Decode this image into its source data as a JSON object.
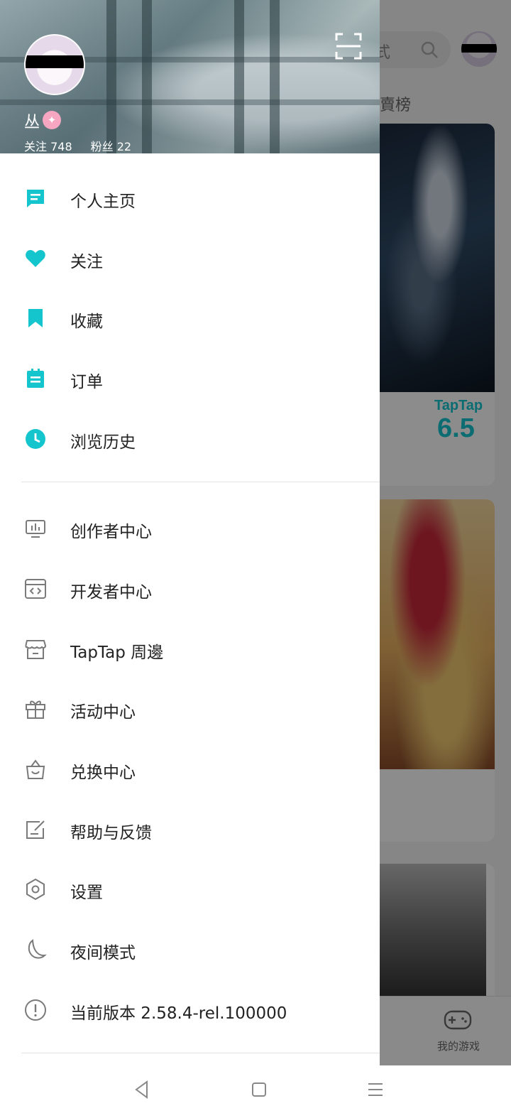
{
  "background": {
    "search_placeholder_fragment": "式",
    "section_title_fragment": "賣榜",
    "score_brand": "TapTap",
    "score_value": "6.5",
    "tab_my_games_label": "我的游戏"
  },
  "drawer": {
    "user": {
      "name": "丛",
      "badge_icon": "unicorn-badge-icon",
      "following": "关注 748",
      "followers": "粉丝 22"
    },
    "primary_items": [
      {
        "label": "个人主页",
        "icon": "profile-card-icon"
      },
      {
        "label": "关注",
        "icon": "heart-icon"
      },
      {
        "label": "收藏",
        "icon": "bookmark-icon"
      },
      {
        "label": "订单",
        "icon": "order-icon"
      },
      {
        "label": "浏览历史",
        "icon": "clock-icon"
      }
    ],
    "secondary_items": [
      {
        "label": "创作者中心",
        "icon": "creator-monitor-icon"
      },
      {
        "label": "开发者中心",
        "icon": "code-window-icon"
      },
      {
        "label": "TapTap 周邊",
        "icon": "store-icon"
      },
      {
        "label": "活动中心",
        "icon": "gift-icon"
      },
      {
        "label": "兑换中心",
        "icon": "shopping-bag-icon"
      },
      {
        "label": "帮助与反馈",
        "icon": "edit-note-icon"
      },
      {
        "label": "设置",
        "icon": "settings-hex-icon"
      },
      {
        "label": "夜间模式",
        "icon": "moon-icon"
      },
      {
        "label": "当前版本 2.58.4-rel.100000",
        "icon": "info-icon"
      }
    ]
  },
  "colors": {
    "accent": "#15c5ce",
    "icon_gray": "#7a7a7a",
    "text": "#222222"
  }
}
